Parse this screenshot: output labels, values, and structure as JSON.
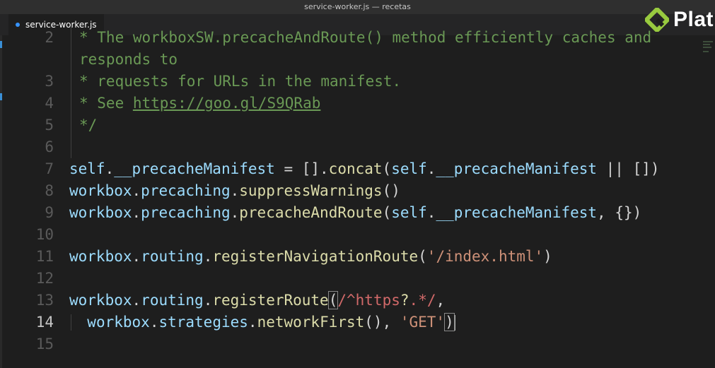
{
  "window": {
    "title": "service-worker.js — recetas"
  },
  "tab": {
    "label": "service-worker.js"
  },
  "brand": {
    "logo_text": "Plat",
    "logo_color": "#98ca3f"
  },
  "editor": {
    "active_line": "14",
    "lines": [
      {
        "n": "2",
        "tokens": [
          [
            "cm",
            "* The workboxSW.precacheAndRoute() method efficiently caches and"
          ]
        ]
      },
      {
        "n": "",
        "tokens": [
          [
            "cm",
            "responds to"
          ]
        ]
      },
      {
        "n": "3",
        "tokens": [
          [
            "cm",
            "* requests for URLs in the manifest."
          ]
        ]
      },
      {
        "n": "4",
        "tokens": [
          [
            "cm",
            "* See "
          ],
          [
            "cm-link",
            "https://goo.gl/S9QRab"
          ]
        ]
      },
      {
        "n": "5",
        "tokens": [
          [
            "cm",
            "*/"
          ]
        ]
      },
      {
        "n": "6",
        "tokens": []
      },
      {
        "n": "7",
        "tokens": [
          [
            "var",
            "self"
          ],
          [
            "punc",
            "."
          ],
          [
            "var",
            "__precacheManifest"
          ],
          [
            "punc",
            " = []."
          ],
          [
            "fn",
            "concat"
          ],
          [
            "punc",
            "("
          ],
          [
            "var",
            "self"
          ],
          [
            "punc",
            "."
          ],
          [
            "var",
            "__precacheManifest"
          ],
          [
            "punc",
            " || [])"
          ]
        ]
      },
      {
        "n": "8",
        "tokens": [
          [
            "var",
            "workbox"
          ],
          [
            "punc",
            "."
          ],
          [
            "var",
            "precaching"
          ],
          [
            "punc",
            "."
          ],
          [
            "fn",
            "suppressWarnings"
          ],
          [
            "punc",
            "()"
          ]
        ]
      },
      {
        "n": "9",
        "tokens": [
          [
            "var",
            "workbox"
          ],
          [
            "punc",
            "."
          ],
          [
            "var",
            "precaching"
          ],
          [
            "punc",
            "."
          ],
          [
            "fn",
            "precacheAndRoute"
          ],
          [
            "punc",
            "("
          ],
          [
            "var",
            "self"
          ],
          [
            "punc",
            "."
          ],
          [
            "var",
            "__precacheManifest"
          ],
          [
            "punc",
            ", {})"
          ]
        ]
      },
      {
        "n": "10",
        "tokens": []
      },
      {
        "n": "11",
        "tokens": [
          [
            "var",
            "workbox"
          ],
          [
            "punc",
            "."
          ],
          [
            "var",
            "routing"
          ],
          [
            "punc",
            "."
          ],
          [
            "fn",
            "registerNavigationRoute"
          ],
          [
            "punc",
            "("
          ],
          [
            "str",
            "'/index.html'"
          ],
          [
            "punc",
            ")"
          ]
        ]
      },
      {
        "n": "12",
        "tokens": []
      },
      {
        "n": "13",
        "tokens": [
          [
            "var",
            "workbox"
          ],
          [
            "punc",
            "."
          ],
          [
            "var",
            "routing"
          ],
          [
            "punc",
            "."
          ],
          [
            "fn",
            "registerRoute"
          ],
          [
            "box",
            "("
          ],
          [
            "rx",
            "/^https"
          ],
          [
            "rxq",
            "?"
          ],
          [
            "rx",
            ".*/"
          ],
          [
            "punc",
            ","
          ]
        ]
      },
      {
        "n": "14",
        "tokens": [
          [
            "punc",
            "  "
          ],
          [
            "var",
            "workbox"
          ],
          [
            "punc",
            "."
          ],
          [
            "var",
            "strategies"
          ],
          [
            "punc",
            "."
          ],
          [
            "fn",
            "networkFirst"
          ],
          [
            "punc",
            "(), "
          ],
          [
            "str",
            "'GET'"
          ],
          [
            "box",
            ")"
          ],
          [
            "cursor",
            ""
          ]
        ]
      },
      {
        "n": "15",
        "tokens": []
      }
    ]
  },
  "colors": {
    "background": "#1e1e1e",
    "comment": "#6a9955",
    "variable": "#9cdcfe",
    "function": "#dcdcaa",
    "string": "#ce9178",
    "regex": "#d16969"
  }
}
